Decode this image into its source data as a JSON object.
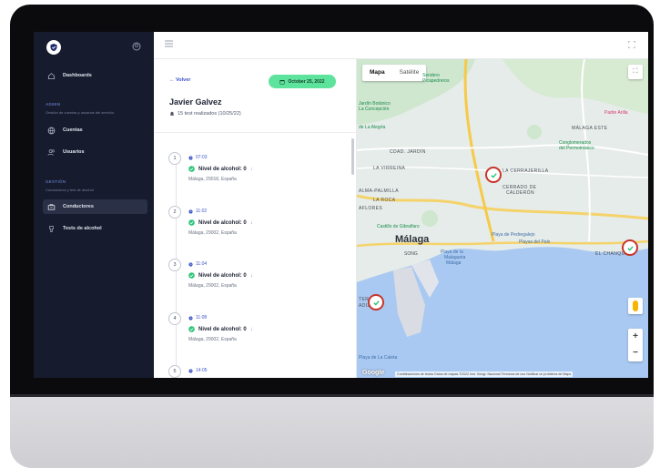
{
  "sidebar": {
    "items": [
      {
        "label": "Dashboards",
        "icon": "home-icon"
      },
      {
        "label": "Cuentas",
        "icon": "globe-icon"
      },
      {
        "label": "Usuarios",
        "icon": "users-icon"
      },
      {
        "label": "Conductores",
        "icon": "car-icon"
      },
      {
        "label": "Tests de alcohol",
        "icon": "breathalyzer-icon"
      }
    ],
    "sections": [
      {
        "title": "ADMIN",
        "subtitle": "Gestión de cuentas y usuarios del servicio."
      },
      {
        "title": "GESTIÓN",
        "subtitle": "Conductores y test de alcohol"
      }
    ]
  },
  "detail": {
    "back_label": "Volver",
    "date": "October 25, 2022",
    "driver_name": "Javier Galvez",
    "tests_summary": "15 test realizados (10/25/22)"
  },
  "timeline": [
    {
      "n": "1",
      "time": "07:03",
      "result": "Nivel de alcohol: 0",
      "location": "Málaga, 29018, España"
    },
    {
      "n": "2",
      "time": "11:02",
      "result": "Nivel de alcohol: 0",
      "location": "Málaga, 29002, España"
    },
    {
      "n": "3",
      "time": "11:04",
      "result": "Nivel de alcohol: 0",
      "location": "Málaga, 29002, España"
    },
    {
      "n": "4",
      "time": "11:08",
      "result": "Nivel de alcohol: 0",
      "location": "Málaga, 29002, España"
    },
    {
      "n": "5",
      "time": "14:05"
    }
  ],
  "map": {
    "tab_map": "Mapa",
    "tab_satellite": "Satélite",
    "attribution": "Combinaciones de teclas   Datos de mapas ©2022 Inst. Geogr. Nacional   Términos de uso   Notificar un problema de Maps",
    "google": "Google",
    "labels": {
      "city": "Málaga",
      "malaga_este": "MÁLAGA ESTE",
      "cdad_jardin": "CDAD. JARDÍN",
      "virreina": "LA VIRREINA",
      "cerrajerilla": "LA CERRAJERILLA",
      "cerrado": "CERRADO DE",
      "calderon": "CALDERÓN",
      "palmilla": "ALMA-PALMILLA",
      "roca": "LA ROCA",
      "aflores": "AFLORES",
      "chanquete": "EL CHANQUETE",
      "tera": "TERA",
      "adiz": "ADIZ",
      "sendero": "Sendero",
      "picapedreros": "Picapedreros",
      "botanico": "Jardín Botánico",
      "concepcion": "La Concepción",
      "alegria": "de La Alegría",
      "padre_arilla": "Padre Arilla",
      "conglomerados": "Conglomerados",
      "permotriasico": "del Permotriásico",
      "gibralfaro": "Castillo de Gibralfaro",
      "pedregalejo": "Playa de Pedregalejo",
      "palo": "Playas del Palo",
      "malagueta_1": "Playa de la",
      "malagueta_2": "Malagueta",
      "malagueta_3": "Málaga",
      "songo": "SONG",
      "caleta": "Playa de La Caleta"
    }
  },
  "colors": {
    "sidebar_bg": "#161b2e",
    "accent_blue": "#3e57c8",
    "badge_green": "#5ee39c",
    "marker_red": "#c8352b"
  }
}
